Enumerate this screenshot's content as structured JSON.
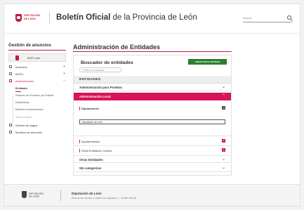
{
  "header": {
    "logo_line1": "DIPUTACIÓN",
    "logo_line2": "DE LEÓN",
    "title_bold": "Boletín Oficial",
    "title_rest": " de la Provincia de León",
    "search_placeholder": "Buscar"
  },
  "sidebar": {
    "title": "Gestión de anuncios",
    "bop_button": "BOP León",
    "items": [
      {
        "label": "Anuncios",
        "icon": "list-icon",
        "toggle": "+"
      },
      {
        "label": "BOP's",
        "icon": "book-icon",
        "toggle": "+"
      },
      {
        "label": "Administración",
        "icon": "admin-icon",
        "toggle": "−"
      }
    ],
    "sub_items": [
      "Entidades",
      "Relación de Permisos por Entidad",
      "Estadísticas",
      "Boletines extraordinarios",
      "Nuevo usuario"
    ],
    "bottom_items": [
      {
        "label": "Gestión de pagos",
        "icon": "payments-icon"
      },
      {
        "label": "Modelos de anuncios",
        "icon": "templates-icon"
      }
    ]
  },
  "main": {
    "title": "Administración de Entidades",
    "panel_title": "Buscador de entidades",
    "create_button": "CREAR NUEVA ENTIDAD",
    "search_placeholder": "Término de búsqueda",
    "entities_header": "ENTIDADES",
    "rows": {
      "pruebas": "Administración para Pruebas",
      "local": "Administración Local",
      "diputaciones": "Diputaciones",
      "diputacion_value": "Diputación de León",
      "ayuntamientos": "Ayuntamientos",
      "otras_locales": "Otras Entidades Locales",
      "otras": "Otras Entidades",
      "sin_categorizar": "Sin categorizar"
    }
  },
  "footer": {
    "logo_line1": "DIPUTACIÓN",
    "logo_line2": "DE LEÓN",
    "name": "Diputación de León",
    "address": "Plaza de San Marcelo 6 | 24002 León (España) | T.: +34 987 292 150"
  },
  "colors": {
    "accent": "#d8125b",
    "brand_red": "#c61a3a",
    "button_green": "#2e7d32"
  }
}
